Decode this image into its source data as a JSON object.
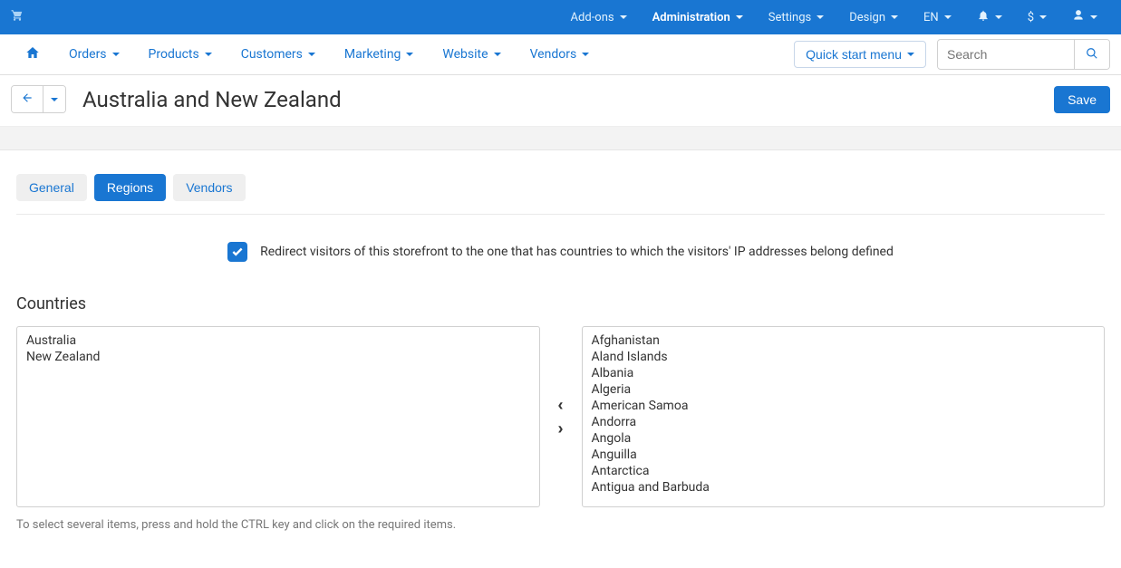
{
  "topbar": {
    "menu": [
      {
        "label": "Add-ons",
        "active": false
      },
      {
        "label": "Administration",
        "active": true
      },
      {
        "label": "Settings",
        "active": false
      },
      {
        "label": "Design",
        "active": false
      }
    ],
    "lang": "EN",
    "currency": "$"
  },
  "navbar": {
    "items": [
      "Orders",
      "Products",
      "Customers",
      "Marketing",
      "Website",
      "Vendors"
    ],
    "quick_start": "Quick start menu",
    "search_placeholder": "Search"
  },
  "page": {
    "title": "Australia and New Zealand",
    "save_label": "Save"
  },
  "tabs": {
    "general": "General",
    "regions": "Regions",
    "vendors": "Vendors",
    "active": "regions"
  },
  "redirect": {
    "checked": true,
    "text": "Redirect visitors of this storefront to the one that has countries to which the visitors' IP addresses belong defined"
  },
  "countries": {
    "section_title": "Countries",
    "selected": [
      "Australia",
      "New Zealand"
    ],
    "available": [
      "Afghanistan",
      "Aland Islands",
      "Albania",
      "Algeria",
      "American Samoa",
      "Andorra",
      "Angola",
      "Anguilla",
      "Antarctica",
      "Antigua and Barbuda"
    ],
    "hint": "To select several items, press and hold the CTRL key and click on the required items."
  },
  "icons": {
    "cart": "cart",
    "home": "home",
    "bell": "bell",
    "user": "user",
    "search": "search",
    "back": "back",
    "check": "check",
    "chev_left": "‹",
    "chev_right": "›"
  }
}
